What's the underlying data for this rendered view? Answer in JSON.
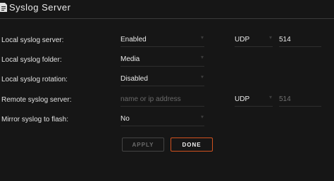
{
  "header": {
    "title": "Syslog Server",
    "icon": "document-icon"
  },
  "rows": {
    "local_server": {
      "label": "Local syslog server:",
      "value": "Enabled",
      "protocol": "UDP",
      "port": "514"
    },
    "local_folder": {
      "label": "Local syslog folder:",
      "value": "Media"
    },
    "local_rotation": {
      "label": "Local syslog rotation:",
      "value": "Disabled"
    },
    "remote_server": {
      "label": "Remote syslog server:",
      "placeholder": "name or ip address",
      "protocol": "UDP",
      "port": "514"
    },
    "mirror_flash": {
      "label": "Mirror syslog to flash:",
      "value": "No"
    }
  },
  "buttons": {
    "apply": "APPLY",
    "done": "DONE"
  },
  "colors": {
    "accent": "#d2521f",
    "background": "#161616",
    "text": "#e6e6e6",
    "muted": "#6a6a6a"
  }
}
